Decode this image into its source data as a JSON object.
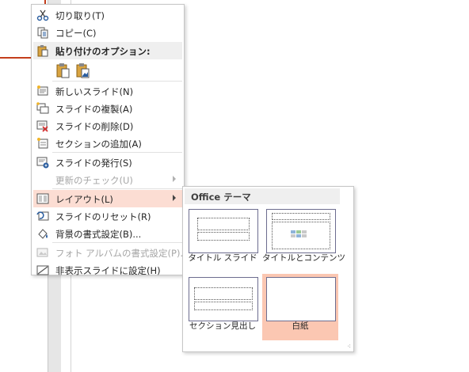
{
  "context_menu": {
    "items": [
      {
        "label": "切り取り(T)",
        "icon": "scissors-icon"
      },
      {
        "label": "コピー(C)",
        "icon": "copy-icon"
      },
      {
        "label": "新しいスライド(N)",
        "icon": "new-slide-icon"
      },
      {
        "label": "スライドの複製(A)",
        "icon": "duplicate-slide-icon"
      },
      {
        "label": "スライドの削除(D)",
        "icon": "delete-slide-icon"
      },
      {
        "label": "セクションの追加(A)",
        "icon": "add-section-icon"
      },
      {
        "label": "スライドの発行(S)",
        "icon": "publish-slides-icon"
      },
      {
        "label": "更新のチェック(U)",
        "icon": "",
        "disabled": true
      },
      {
        "label": "レイアウト(L)",
        "icon": "layout-icon"
      },
      {
        "label": "スライドのリセット(R)",
        "icon": "reset-slide-icon"
      },
      {
        "label": "背景の書式設定(B)...",
        "icon": "format-background-icon"
      },
      {
        "label": "フォト アルバムの書式設定(P)...",
        "icon": "photo-album-icon",
        "disabled": true
      },
      {
        "label": "非表示スライドに設定(H)",
        "icon": "hide-slide-icon"
      }
    ],
    "paste_options_label": "貼り付けのオプション:"
  },
  "layout_submenu": {
    "header": "Office テーマ",
    "layouts": [
      {
        "label": "タイトル スライド"
      },
      {
        "label": "タイトルとコンテンツ"
      },
      {
        "label": "セクション見出し"
      },
      {
        "label": "白紙",
        "selected": true
      }
    ]
  },
  "colors": {
    "accent": "#c43e1c",
    "highlight": "#fcddd3",
    "selected": "#fbc7b2"
  }
}
